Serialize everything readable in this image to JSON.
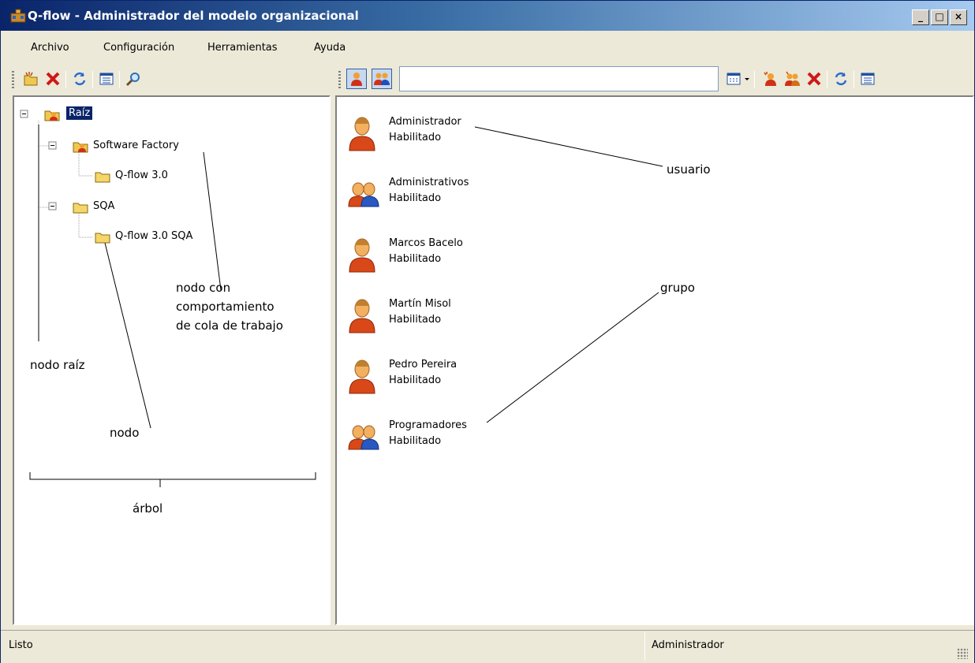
{
  "window": {
    "title": "Q-flow - Administrador del modelo organizacional"
  },
  "menu": [
    "Archivo",
    "Configuración",
    "Herramientas",
    "Ayuda"
  ],
  "tree": {
    "nodes": [
      {
        "label": "Raíz",
        "type": "root",
        "selected": true
      },
      {
        "label": "Software Factory",
        "type": "queue"
      },
      {
        "label": "Q-flow 3.0",
        "type": "folder"
      },
      {
        "label": "SQA",
        "type": "folder"
      },
      {
        "label": "Q-flow 3.0 SQA",
        "type": "folder"
      }
    ]
  },
  "list": {
    "items": [
      {
        "name": "Administrador",
        "status": "Habilitado",
        "type": "user"
      },
      {
        "name": "Administrativos",
        "status": "Habilitado",
        "type": "group"
      },
      {
        "name": "Marcos Bacelo",
        "status": "Habilitado",
        "type": "user"
      },
      {
        "name": "Martín Misol",
        "status": "Habilitado",
        "type": "user"
      },
      {
        "name": "Pedro Pereira",
        "status": "Habilitado",
        "type": "user"
      },
      {
        "name": "Programadores",
        "status": "Habilitado",
        "type": "group"
      }
    ]
  },
  "annotations": {
    "usuario": "usuario",
    "grupo": "grupo",
    "nodo_cola_1": "nodo con",
    "nodo_cola_2": "comportamiento",
    "nodo_cola_3": "de cola de trabajo",
    "nodo_raiz": "nodo raíz",
    "nodo": "nodo",
    "arbol": "árbol"
  },
  "status": {
    "left": "Listo",
    "right": "Administrador"
  },
  "colors": {
    "titlebar": "#0a246a",
    "selection": "#0a246a",
    "chrome": "#ece9d8"
  }
}
